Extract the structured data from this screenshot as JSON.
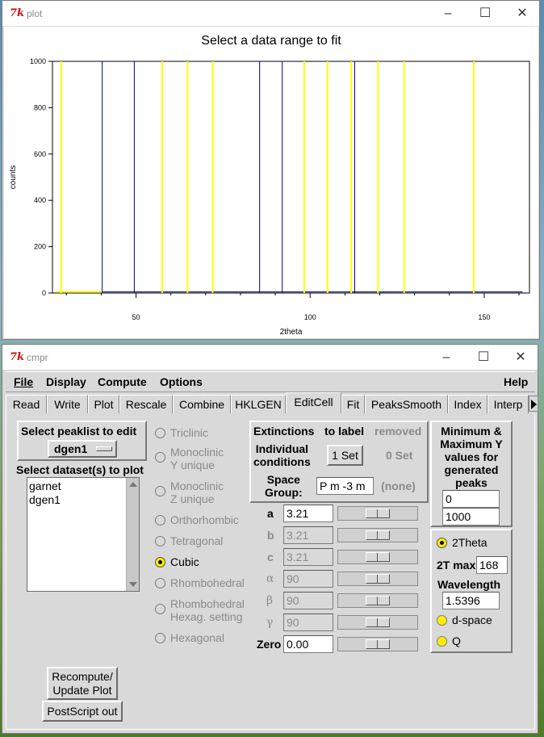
{
  "plot_window": {
    "title": "plot",
    "plot_title": "Select a data range to fit",
    "icon_text": "7k"
  },
  "chart_data": {
    "type": "line",
    "xlabel": "2theta",
    "ylabel": "counts",
    "xlim": [
      26,
      163
    ],
    "ylim": [
      0,
      1000
    ],
    "x_ticks": [
      50,
      100,
      150
    ],
    "y_ticks": [
      0,
      200,
      400,
      600,
      800,
      1000
    ],
    "series": [
      {
        "color": "#ffff00",
        "x": [
          28.5,
          57.5,
          64.8,
          72.0,
          98.3,
          105.0,
          111.8,
          119.5,
          127.0,
          147.0
        ],
        "values": [
          1000,
          1000,
          1000,
          1000,
          1000,
          1000,
          1000,
          1000,
          1000,
          1000
        ]
      },
      {
        "color": "#000080",
        "x": [
          40.3,
          49.5,
          85.5,
          92.0,
          112.8
        ],
        "values": [
          1000,
          1000,
          1000,
          1000,
          1000
        ]
      }
    ],
    "baseline_segments": [
      {
        "color": "#ffff00",
        "x": [
          27,
          40.3
        ],
        "y": [
          5,
          5
        ]
      },
      {
        "color": "#000080",
        "x": [
          40.3,
          161
        ],
        "y": [
          5,
          5
        ]
      }
    ]
  },
  "cmpr_window": {
    "title": "cmpr",
    "icon_text": "7k",
    "menus": {
      "file": "File",
      "display": "Display",
      "compute": "Compute",
      "options": "Options",
      "help": "Help"
    },
    "tabs": [
      "Read",
      "Write",
      "Plot",
      "Rescale",
      "Combine",
      "HKLGEN",
      "EditCell",
      "Fit",
      "PeaksSmooth",
      "Index",
      "Interp"
    ],
    "active_tab": "EditCell",
    "peaklist": {
      "label": "Select peaklist to edit",
      "value": "dgen1"
    },
    "datasets": {
      "label": "Select dataset(s) to plot",
      "items": [
        "garnet",
        "dgen1"
      ]
    },
    "lattice_types": [
      {
        "label": "Triclinic",
        "selected": false
      },
      {
        "label": "Monoclinic\nY unique",
        "selected": false
      },
      {
        "label": "Monoclinic\nZ unique",
        "selected": false
      },
      {
        "label": "Orthorhombic",
        "selected": false
      },
      {
        "label": "Tetragonal",
        "selected": false
      },
      {
        "label": "Cubic",
        "selected": true
      },
      {
        "label": "Rhombohedral",
        "selected": false
      },
      {
        "label": "Rhombohedral\nHexag. setting",
        "selected": false
      },
      {
        "label": "Hexagonal",
        "selected": false
      }
    ],
    "extinctions": {
      "title": "Extinctions",
      "to_label": "to label",
      "removed": "removed",
      "individual": "Individual\nconditions",
      "set_button": "1 Set",
      "removed_count": "0 Set",
      "space_group_label": "Space\nGroup:",
      "space_group_value": "P m -3 m",
      "space_group_status": "(none)"
    },
    "cell": {
      "a": {
        "label": "a",
        "value": "3.21"
      },
      "b": {
        "label": "b",
        "value": "3.21"
      },
      "c": {
        "label": "c",
        "value": "3.21"
      },
      "alpha": {
        "label": "α",
        "value": "90"
      },
      "beta": {
        "label": "β",
        "value": "90"
      },
      "gamma": {
        "label": "γ",
        "value": "90"
      },
      "zero": {
        "label": "Zero",
        "value": "0.00"
      }
    },
    "minmax": {
      "title": "Minimum &\nMaximum Y\nvalues for\ngenerated\npeaks",
      "min": "0",
      "max": "1000"
    },
    "xaxis": {
      "twotheta": "2Theta",
      "twotheta_selected": true,
      "tmax_label": "2T max",
      "tmax_value": "168",
      "wavelength_label": "Wavelength",
      "wavelength_value": "1.5396",
      "dspace": "d-space",
      "q": "Q"
    },
    "buttons": {
      "recompute": "Recompute/\nUpdate Plot",
      "postscript": "PostScript out"
    }
  }
}
